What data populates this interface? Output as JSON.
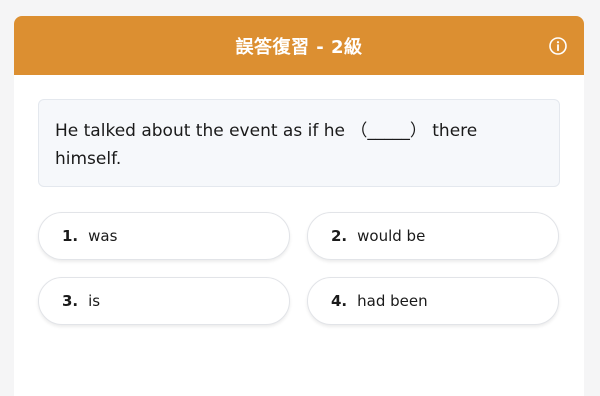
{
  "header": {
    "title": "誤答復習 - 2級",
    "color": "#dc8f31",
    "info_icon": "info-circle-icon"
  },
  "question": {
    "text": "He talked about the event as if he （_____） there\nhimself."
  },
  "options": [
    {
      "number": "1.",
      "text": "was"
    },
    {
      "number": "2.",
      "text": "would be"
    },
    {
      "number": "3.",
      "text": "is"
    },
    {
      "number": "4.",
      "text": "had been"
    }
  ]
}
